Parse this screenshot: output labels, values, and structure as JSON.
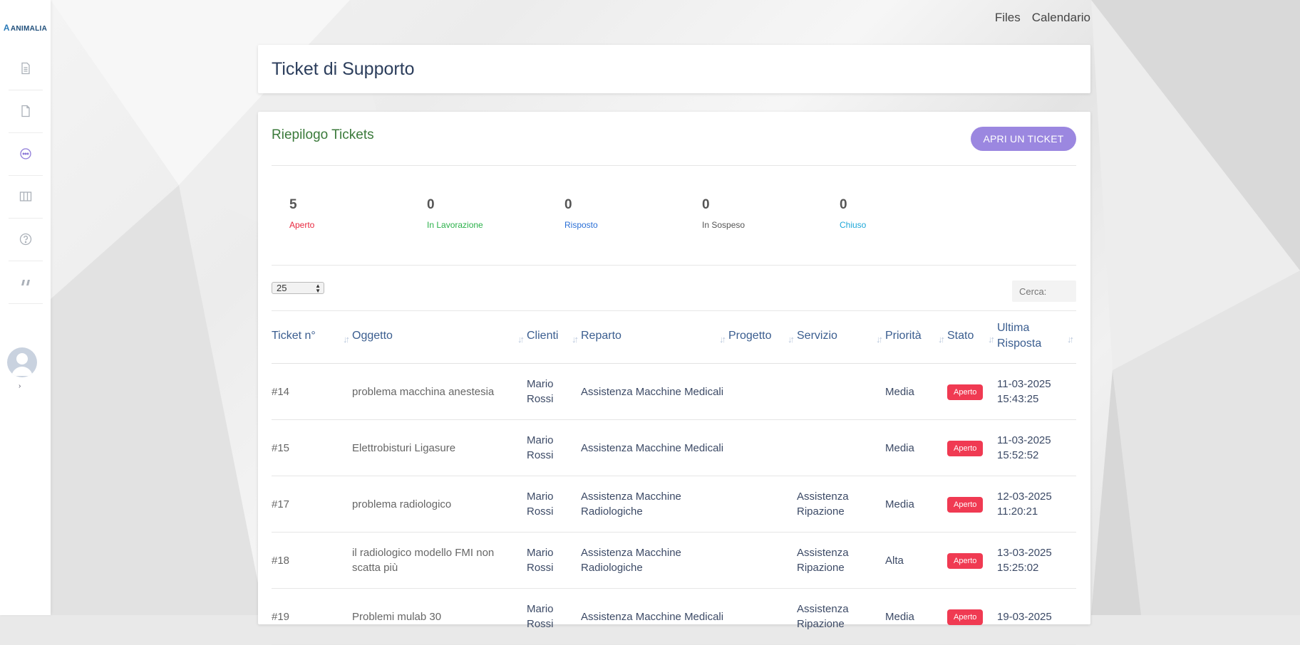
{
  "brand": {
    "name": "ANIMALIA",
    "mark": "A"
  },
  "sidebar": {
    "items": [
      {
        "name": "document-icon"
      },
      {
        "name": "file-icon"
      },
      {
        "name": "chat-icon",
        "active_color": "#8e7ad8"
      },
      {
        "name": "columns-icon"
      },
      {
        "name": "help-icon"
      },
      {
        "name": "quote-icon"
      }
    ],
    "expand_glyph": "›"
  },
  "top_links": {
    "files": "Files",
    "calendar": "Calendario"
  },
  "page_title": "Ticket di Supporto",
  "summary": {
    "title": "Riepilogo Tickets",
    "open_button": "APRI UN TICKET",
    "stats": [
      {
        "value": "5",
        "label": "Aperto",
        "color": "#e8283f"
      },
      {
        "value": "0",
        "label": "In Lavorazione",
        "color": "#2bb14a"
      },
      {
        "value": "0",
        "label": "Risposto",
        "color": "#2a6fd6"
      },
      {
        "value": "0",
        "label": "In Sospeso",
        "color": "#555555"
      },
      {
        "value": "0",
        "label": "Chiuso",
        "color": "#1ea7d8"
      }
    ]
  },
  "table_controls": {
    "page_length": "25",
    "search_placeholder": "Cerca:"
  },
  "table": {
    "headers": [
      "Ticket n°",
      "Oggetto",
      "Clienti",
      "Reparto",
      "Progetto",
      "Servizio",
      "Priorità",
      "Stato",
      "Ultima Risposta"
    ],
    "rows": [
      {
        "id": "#14",
        "oggetto": "problema macchina anestesia",
        "cliente": "Mario Rossi",
        "reparto": "Assistenza Macchine Medicali",
        "progetto": "",
        "servizio": "",
        "priorita": "Media",
        "stato": "Aperto",
        "ultima_data": "11-03-2025",
        "ultima_ora": "15:43:25"
      },
      {
        "id": "#15",
        "oggetto": "Elettrobisturi Ligasure",
        "cliente": "Mario Rossi",
        "reparto": "Assistenza Macchine Medicali",
        "progetto": "",
        "servizio": "",
        "priorita": "Media",
        "stato": "Aperto",
        "ultima_data": "11-03-2025",
        "ultima_ora": "15:52:52"
      },
      {
        "id": "#17",
        "oggetto": "problema radiologico",
        "cliente": "Mario Rossi",
        "reparto": "Assistenza Macchine Radiologiche",
        "progetto": "",
        "servizio": "Assistenza Ripazione",
        "priorita": "Media",
        "stato": "Aperto",
        "ultima_data": "12-03-2025",
        "ultima_ora": "11:20:21"
      },
      {
        "id": "#18",
        "oggetto": "il radiologico modello FMI non scatta più",
        "cliente": "Mario Rossi",
        "reparto": "Assistenza Macchine Radiologiche",
        "progetto": "",
        "servizio": "Assistenza Ripazione",
        "priorita": "Alta",
        "stato": "Aperto",
        "ultima_data": "13-03-2025",
        "ultima_ora": "15:25:02"
      },
      {
        "id": "#19",
        "oggetto": "Problemi mulab 30",
        "cliente": "Mario Rossi",
        "reparto": "Assistenza Macchine Medicali",
        "progetto": "",
        "servizio": "Assistenza Ripazione",
        "priorita": "Media",
        "stato": "Aperto",
        "ultima_data": "19-03-2025",
        "ultima_ora": ""
      }
    ]
  }
}
